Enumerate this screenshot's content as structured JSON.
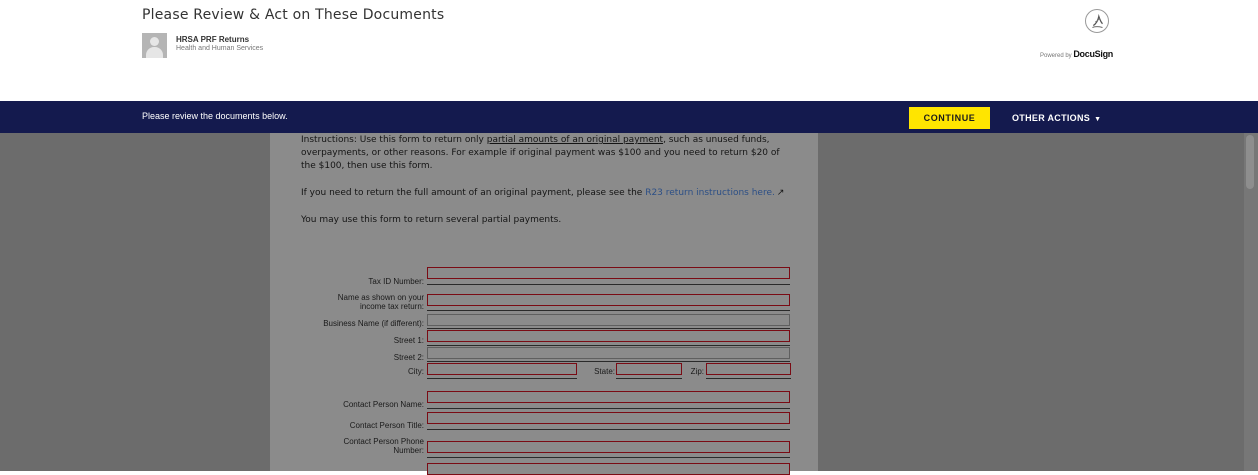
{
  "header": {
    "title": "Please Review & Act on These Documents",
    "sender_name": "HRSA PRF Returns",
    "sender_org": "Health and Human Services",
    "powered_by_prefix": "Powered by",
    "powered_by_brand": "DocuSign"
  },
  "action_bar": {
    "message": "Please review the documents below.",
    "continue_label": "CONTINUE",
    "other_actions_label": "OTHER ACTIONS",
    "caret": "▼"
  },
  "document": {
    "instructions": {
      "lead": "Instructions: Use this form to return only ",
      "underlined": "partial amounts of an original payment",
      "rest": ", such as unused funds, overpayments, or other reasons. For example if original payment was $100 and you need to return $20 of the $100, then use this form."
    },
    "full_return": {
      "lead": "If you need to return the full amount of an original payment, please see the ",
      "link": "R23 return instructions here.",
      "icon": "external-link-icon"
    },
    "several": "You may use this form to return several partial payments.",
    "fields": {
      "tax_id": "Tax ID Number:",
      "name_line1": "Name as shown on your",
      "name_line2": "income tax return:",
      "business": "Business Name (if different):",
      "street1": "Street 1:",
      "street2": "Street 2:",
      "city": "City:",
      "state": "State:",
      "zip": "Zip:",
      "contact_name": "Contact Person Name:",
      "contact_title": "Contact Person Title:",
      "phone_line1": "Contact Person Phone",
      "phone_line2": "Number:"
    }
  },
  "colors": {
    "nav_bar": "#141a4e",
    "continue_button": "#ffe500",
    "required_field_border": "#7a0b14",
    "link": "#2c4f86"
  }
}
